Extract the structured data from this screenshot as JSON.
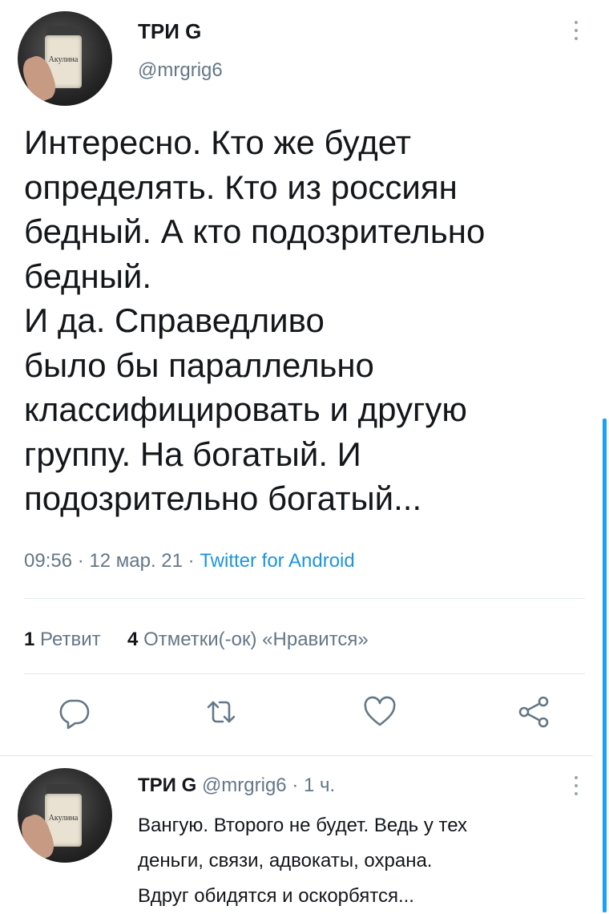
{
  "tweet": {
    "author_name": "ТРИ G",
    "author_handle": "@mrgrig6",
    "avatar_label": "Акулина",
    "text_lines": [
      "Интересно. Кто же будет",
      "определять.  Кто из россиян",
      "бедный. А кто подозрительно",
      "бедный.",
      "И да. Справедливо",
      "было бы параллельно",
      "классифицировать и другую",
      "группу. На богатый. И",
      "подозрительно богатый..."
    ],
    "time": "09:56",
    "separator": " · ",
    "date": "12 мар. 21",
    "source": "Twitter for Android"
  },
  "stats": {
    "retweets_count": "1",
    "retweets_label": "Ретвит",
    "likes_count": "4",
    "likes_label": "Отметки(-ок) «Нравится»"
  },
  "actions": {
    "reply_icon": "reply-icon",
    "retweet_icon": "retweet-icon",
    "like_icon": "heart-icon",
    "share_icon": "share-icon"
  },
  "reply": {
    "author_name": "ТРИ G",
    "author_handle": "@mrgrig6",
    "separator": " · ",
    "time_ago": "1 ч.",
    "avatar_label": "Акулина",
    "text_lines": [
      "Вангую. Второго не будет. Ведь у тех",
      "деньги, связи, адвокаты, охрана.",
      "Вдруг обидятся и оскорбятся..."
    ]
  },
  "colors": {
    "accent": "#1da1f2",
    "link": "#1b95e0",
    "secondary_text": "#657786",
    "primary_text": "#14171a"
  }
}
